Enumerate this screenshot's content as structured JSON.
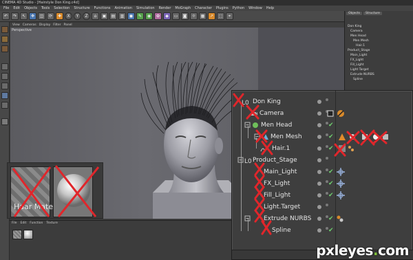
{
  "app": {
    "title": "CINEMA 4D Studio - [Hairstyle Don King.c4d]"
  },
  "menu": [
    "File",
    "Edit",
    "Objects",
    "Tools",
    "Selection",
    "Structure",
    "Functions",
    "Animation",
    "Simulation",
    "Render",
    "MoGraph",
    "Character",
    "Plugins",
    "Python",
    "Window",
    "Help"
  ],
  "viewport": {
    "menu": [
      "View",
      "Cameras",
      "Display",
      "Filter",
      "Panel"
    ],
    "label": "Perspective"
  },
  "material": {
    "label": "Haar Material"
  },
  "bottom_menu": [
    "File",
    "Edit",
    "Function",
    "Texture"
  ],
  "small_panel": {
    "tabs": [
      "Objects",
      "Structure"
    ],
    "rows": [
      "Don King",
      "Camera",
      "Men Head",
      "Men Mesh",
      "Hair.1",
      "Product_Stage",
      "Main_Light",
      "FX_Light",
      "Fill_Light",
      "Light Target",
      "Extrude NURBS",
      "Spline"
    ]
  },
  "objects": [
    {
      "name": "Don King",
      "depth": 0,
      "checked": false
    },
    {
      "name": "Camera",
      "depth": 1,
      "checked": false
    },
    {
      "name": "Men Head",
      "depth": 1,
      "checked": true
    },
    {
      "name": "Men Mesh",
      "depth": 2,
      "checked": true
    },
    {
      "name": "Hair.1",
      "depth": 3,
      "checked": true
    },
    {
      "name": "Product_Stage",
      "depth": 0,
      "checked": false
    },
    {
      "name": "Main_Light",
      "depth": 1,
      "checked": true
    },
    {
      "name": "FX_Light",
      "depth": 1,
      "checked": true
    },
    {
      "name": "Fill_Light",
      "depth": 1,
      "checked": true
    },
    {
      "name": "Light.Target",
      "depth": 1,
      "checked": false
    },
    {
      "name": "Extrude NURBS",
      "depth": 1,
      "checked": true
    },
    {
      "name": "Spline",
      "depth": 2,
      "checked": true
    }
  ],
  "colors": {
    "cross": "#e0262b",
    "check": "#6fd06f",
    "accent_orange": "#d98a2b"
  },
  "watermark": {
    "name": "pxleyes",
    "dot": ".",
    "tld": "com"
  }
}
